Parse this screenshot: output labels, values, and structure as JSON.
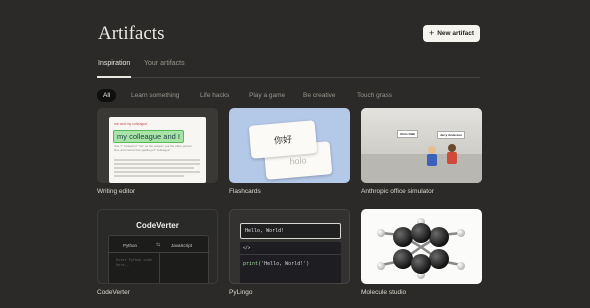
{
  "header": {
    "title": "Artifacts",
    "new_button": "New artifact"
  },
  "tabs": [
    {
      "label": "Inspiration",
      "active": true
    },
    {
      "label": "Your artifacts",
      "active": false
    }
  ],
  "filters": [
    {
      "label": "All",
      "active": true
    },
    {
      "label": "Learn something",
      "active": false
    },
    {
      "label": "Life hacks",
      "active": false
    },
    {
      "label": "Play a game",
      "active": false
    },
    {
      "label": "Be creative",
      "active": false
    },
    {
      "label": "Touch grass",
      "active": false
    }
  ],
  "cards": [
    {
      "caption": "Writing editor",
      "preview": {
        "label": "me and my colleague",
        "highlight": "my colleague and I",
        "note": "Use \"I\" instead of \"me\" as the subject, put the other person first, and correct the spelling of \"colleague\""
      }
    },
    {
      "caption": "Flashcards",
      "preview": {
        "front": "你好",
        "back": "holo"
      }
    },
    {
      "caption": "Anthropic office simulator",
      "preview": {
        "sign_1": "Chris Olah",
        "sign_2": "Jerry Anderson"
      }
    },
    {
      "caption": "CodeVerter",
      "preview": {
        "title": "CodeVerter",
        "from": "Python",
        "swap": "⇆",
        "to": "JavaScript",
        "placeholder": "Enter Python code here..."
      }
    },
    {
      "caption": "PyLingo",
      "preview": {
        "input": "Hello, World!",
        "tag": "</>",
        "code_fn": "print",
        "code_rest": "('Hello, World!')"
      }
    },
    {
      "caption": "Molecule studio"
    }
  ],
  "colors": {
    "background": "#2b2a28",
    "primary_button": "#f5f4ef",
    "active_chip": "#0f0f0e"
  }
}
